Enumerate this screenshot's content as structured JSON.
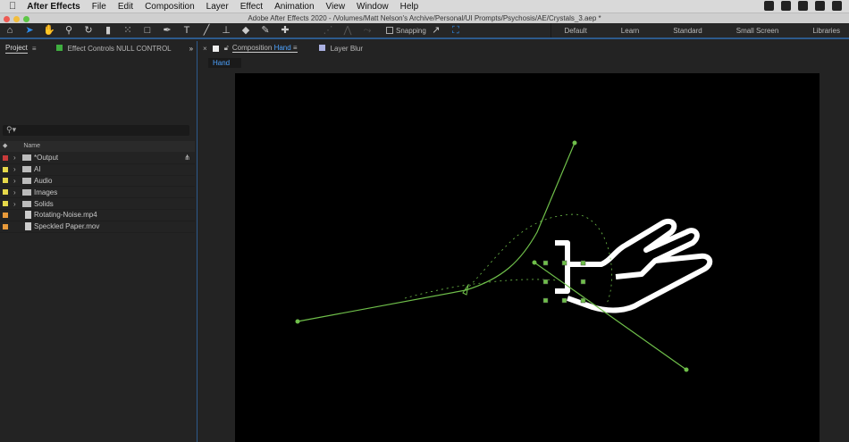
{
  "menubar": {
    "app": "After Effects",
    "items": [
      "File",
      "Edit",
      "Composition",
      "Layer",
      "Effect",
      "Animation",
      "View",
      "Window",
      "Help"
    ]
  },
  "titlebar": {
    "title": "Adobe After Effects 2020 - /Volumes/Matt Nelson's Archive/Personal/UI Prompts/Psychosis/AE/Crystals_3.aep *"
  },
  "toolbar": {
    "snapping": "Snapping",
    "workspaces": [
      "Default",
      "Learn",
      "Standard",
      "Small Screen",
      "Libraries"
    ]
  },
  "project": {
    "tab": "Project",
    "effect_tab": "Effect Controls NULL CONTROL",
    "column_name": "Name",
    "items": [
      {
        "name": "*Output",
        "color": "#c83a3a",
        "type": "folder"
      },
      {
        "name": "AI",
        "color": "#e6d84a",
        "type": "folder"
      },
      {
        "name": "Audio",
        "color": "#e6d84a",
        "type": "folder"
      },
      {
        "name": "Images",
        "color": "#e6d84a",
        "type": "folder"
      },
      {
        "name": "Solids",
        "color": "#e6d84a",
        "type": "folder"
      },
      {
        "name": "Rotating-Noise.mp4",
        "color": "#e89a3a",
        "type": "file"
      },
      {
        "name": "Speckled Paper.mov",
        "color": "#e89a3a",
        "type": "file"
      }
    ]
  },
  "composition": {
    "tab_prefix": "Composition",
    "tab_name": "Hand",
    "layer_tab": "Layer Blur",
    "subtab": "Hand"
  },
  "colors": {
    "accent": "#2d8ceb",
    "path": "#6fbf4a"
  }
}
